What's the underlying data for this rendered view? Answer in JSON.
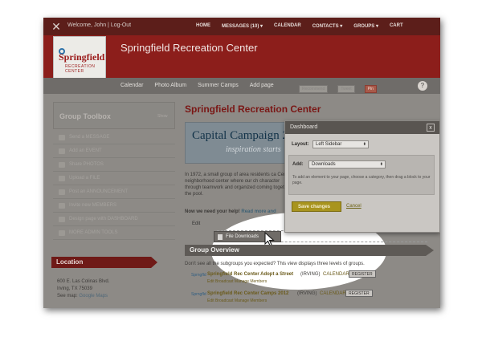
{
  "topbar": {
    "welcome": "Welcome, John | Log-Out",
    "nav": [
      "HOME",
      "MESSAGES (10) ▾",
      "CALENDAR",
      "CONTACTS ▾",
      "GROUPS ▾",
      "CART"
    ]
  },
  "site": {
    "title": "Springfield Recreation Center",
    "logo_line1": "Springfield",
    "logo_line2": "RECREATION CENTER"
  },
  "subnav": {
    "items": [
      "Calendar",
      "Photo Album",
      "Summer Camps",
      "Add page"
    ],
    "help": "?"
  },
  "social": [
    "Recommend",
    "Tweet",
    "Pin"
  ],
  "toolbox": {
    "title": "Group Toolbox",
    "show": "Show",
    "items": [
      "Send a MESSAGE",
      "Add an EVENT",
      "Share PHOTOS",
      "Upload a FILE",
      "Post an ANNOUNCEMENT",
      "Invite new MEMBERS",
      "Design page with DASHBOARD",
      "MORE ADMIN TOOLS"
    ]
  },
  "location": {
    "title": "Location",
    "line1": "600 E. Las Colinas Blvd.",
    "line2": "Irving, TX 75039",
    "map_prefix": "See map:",
    "map_link": "Google Maps"
  },
  "main": {
    "title": "Springfield Recreation Center",
    "banner_line1": "Capital Campaign 20",
    "banner_line2": "inspiration starts",
    "paragraph": "In 1972, a small group of area residents ca Center, a neighborhood center where our ch character through teamwork and organized coming together at the pool.",
    "need_help": "Now we need your help!",
    "read_more": "Read more and",
    "edit_label": "Edit",
    "file_downloads": "File Downloads"
  },
  "groups": {
    "title": "Group Overview",
    "note": "Don't see all the subgroups you expected? This view displays three levels of groups.",
    "rows": [
      {
        "logo": "Sprngfld",
        "name": "Springfield Rec Center Adopt a Street",
        "loc": "(IRVING)",
        "cal": "CALENDAR",
        "btn": "REGISTER",
        "sub": "Edit Broadcast Manage Members"
      },
      {
        "logo": "Sprngfld",
        "name": "Springfield Rec Center Camps 2012",
        "loc": "(IRVING)",
        "cal": "CALENDAR",
        "btn": "REGISTER",
        "sub": "Edit Broadcast Manage Members"
      }
    ]
  },
  "dialog": {
    "title": "Dashboard",
    "close": "x",
    "layout_label": "Layout:",
    "layout_value": "Left Sidebar",
    "add_label": "Add:",
    "add_value": "Downloads",
    "help_text": "To add an element to your page, choose a category, then drag a block to your page.",
    "save": "Save changes",
    "cancel": "Cancel"
  }
}
